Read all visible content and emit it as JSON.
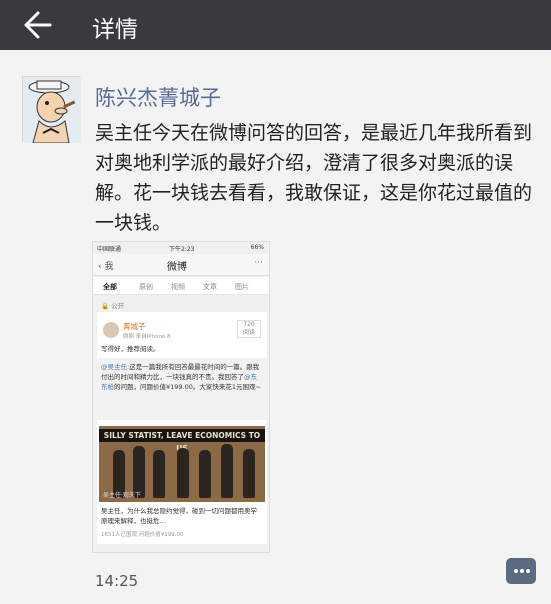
{
  "topbar": {
    "title": "详情",
    "back_icon": "back-arrow-icon"
  },
  "post": {
    "username": "陈兴杰菁城子",
    "avatar_icon": "popeye-avatar",
    "text": "吴主任今天在微博问答的回答，是最近几年我所看到对奥地利学派的最好介绍，澄清了很多对奥派的误解。花一块钱去看看，我敢保证，这是你花过最值的一块钱。",
    "time": "14:25"
  },
  "screenshot": {
    "status": {
      "carrier": "中国联通",
      "time": "下午2:23",
      "battery": "66%"
    },
    "nav": {
      "back": "我",
      "title": "微博"
    },
    "tabs": [
      "全部",
      "原创",
      "视频",
      "文章",
      "图片"
    ],
    "visibility": "公开",
    "author": "菁城子",
    "meta": "刚刚  来自iPhone 8",
    "count": "720",
    "count_label": "阅读",
    "comment": "写得好，推荐阅读。",
    "quote_user": "@吴主任:",
    "quote_text": "这是一篇我所有回答最最花时间的一篇。跟我付出的时间和精力比，一块钱真的不贵。我回答了",
    "quote_mention": "@东东枪",
    "quote_text2": "的问题，问题价值¥199.00。大家快来花1元围观~",
    "image_title": "SILLY STATIST, LEAVE ECONOMICS TO US",
    "image_watermark": "吴主任·观天下",
    "answer_text": "吴主任，为什么我总隐约觉得，碰到一切问题都用奥学原理来解释，也挺危…",
    "answer_meta": "1651人已围观  问题价值¥199.00"
  },
  "more_icon": "more-dots-icon"
}
